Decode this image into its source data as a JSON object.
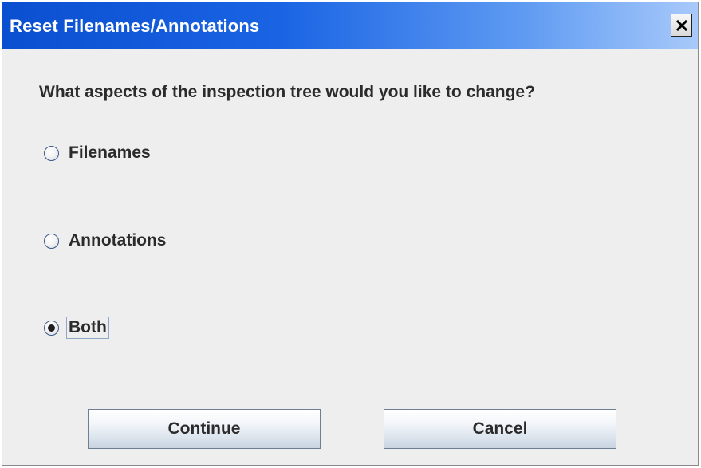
{
  "window": {
    "title": "Reset Filenames/Annotations",
    "close_icon": "close-icon"
  },
  "prompt": {
    "question": "What aspects of the inspection tree would you like to change?"
  },
  "options": [
    {
      "label": "Filenames",
      "selected": false
    },
    {
      "label": "Annotations",
      "selected": false
    },
    {
      "label": "Both",
      "selected": true
    }
  ],
  "buttons": {
    "continue_label": "Continue",
    "cancel_label": "Cancel"
  },
  "colors": {
    "titlebar_start": "#0a4fd0",
    "titlebar_end": "#a8c9fa",
    "dialog_background": "#eeeeee"
  }
}
